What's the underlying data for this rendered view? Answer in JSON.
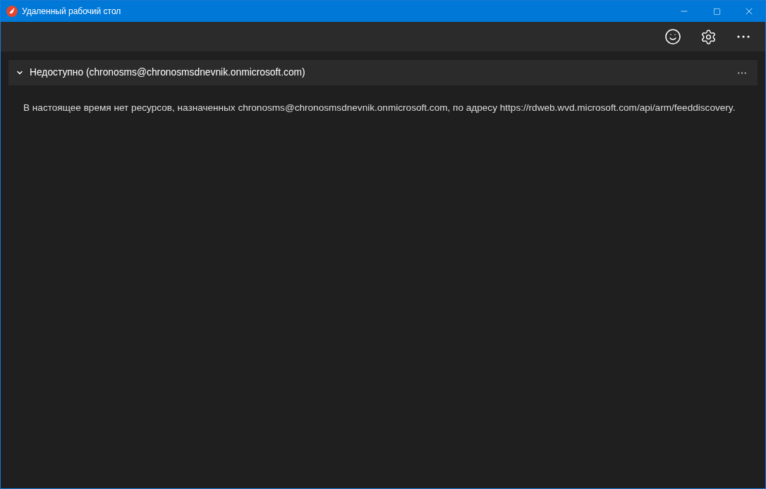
{
  "window": {
    "title": "Удаленный рабочий стол"
  },
  "group": {
    "title": "Недоступно (chronosms@chronosmsdnevnik.onmicrosoft.com)",
    "expanded": true,
    "message": "В настоящее время нет ресурсов, назначенных chronosms@chronosmsdnevnik.onmicrosoft.com, по адресу https://rdweb.wvd.microsoft.com/api/arm/feeddiscovery."
  }
}
